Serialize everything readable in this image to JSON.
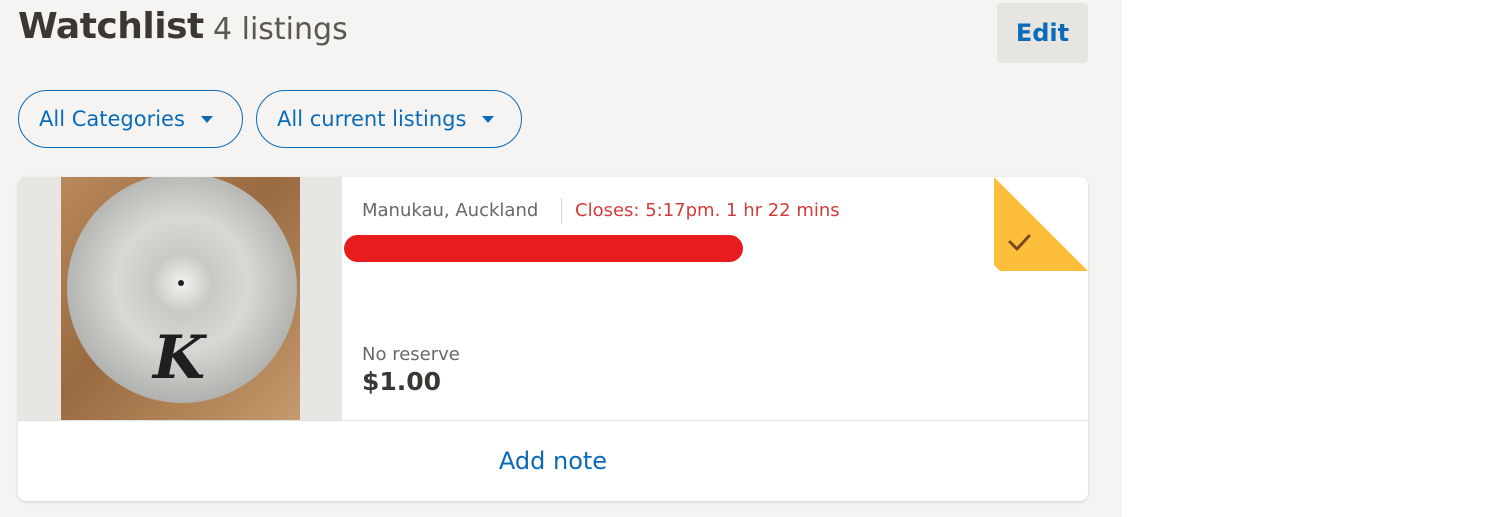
{
  "header": {
    "title": "Watchlist",
    "count": "4 listings",
    "edit_label": "Edit"
  },
  "filters": [
    {
      "label": "All Categories"
    },
    {
      "label": "All current listings"
    }
  ],
  "listing": {
    "location": "Manukau, Auckland",
    "closes": "Closes: 5:17pm. 1 hr 22 mins",
    "reserve": "No reserve",
    "price": "$1.00",
    "add_note_label": "Add note",
    "watched": true,
    "image_icon": "cymbal-photo",
    "image_text": "K"
  },
  "colors": {
    "accent": "#0a6bb8",
    "closing": "#d33c3c",
    "watch_flag": "#fdbf3b",
    "redaction": "#e81c1c"
  }
}
